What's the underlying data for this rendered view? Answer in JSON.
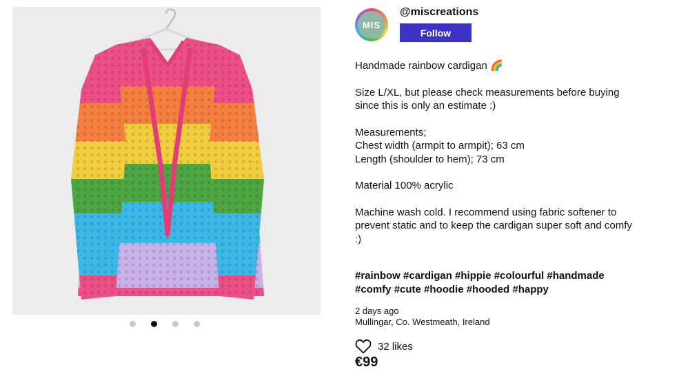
{
  "product": {
    "image_alt": "Crocheted rainbow striped hooded cardigan on a hanger"
  },
  "carousel": {
    "count": 4,
    "active_index": 1
  },
  "seller": {
    "username": "@miscreations",
    "avatar_text": "MIS",
    "follow_label": "Follow"
  },
  "description": {
    "title": "Handmade rainbow cardigan 🌈",
    "size_line1": "Size L/XL, but please check measurements before buying",
    "size_line2": "since this is only an estimate :)",
    "measurements_title": "Measurements;",
    "chest": "Chest width (armpit to armpit); 63 cm",
    "length": "Length (shoulder to hem); 73 cm",
    "material": "Material 100% acrylic",
    "care_line1": "Machine wash cold. I recommend using fabric softener to",
    "care_line2": "prevent static and to keep the cardigan super soft and comfy",
    "care_line3": ":)"
  },
  "hashtags": {
    "line1": "#rainbow #cardigan #hippie #colourful #handmade",
    "line2": "#comfy #cute #hoodie #hooded #happy"
  },
  "meta": {
    "posted": "2 days ago",
    "location": "Mullingar, Co. Westmeath, Ireland"
  },
  "likes": {
    "label": "32 likes"
  },
  "price": "€99",
  "colors": {
    "follow_button": "#3d32c4",
    "stripes": [
      "#ec4f86",
      "#f47f3e",
      "#f1ce3d",
      "#4ea543",
      "#3cb8e6",
      "#c9b1ea"
    ],
    "background": "#ececec"
  }
}
